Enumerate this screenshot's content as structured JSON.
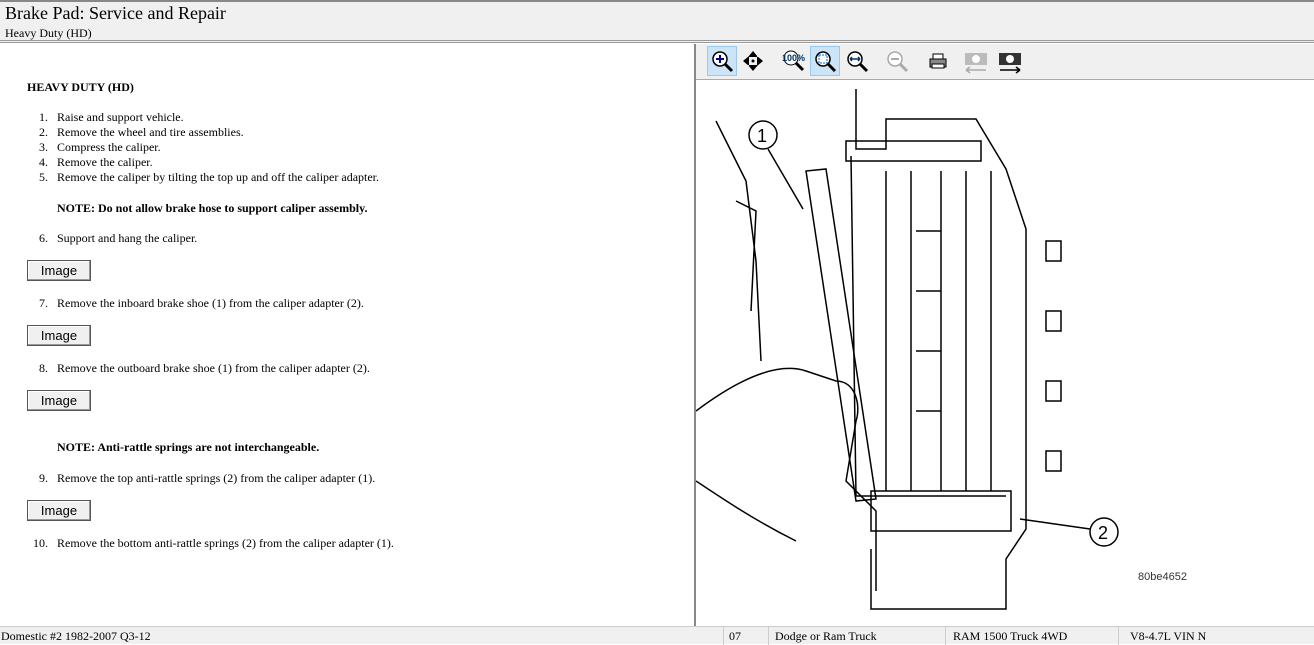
{
  "header": {
    "title": "Brake Pad:  Service and Repair",
    "subtitle": "Heavy Duty (HD)"
  },
  "content": {
    "heading": "HEAVY DUTY (HD)",
    "steps": [
      {
        "n": "1.",
        "text": "Raise and support vehicle."
      },
      {
        "n": "2.",
        "text": "Remove the wheel and tire assemblies."
      },
      {
        "n": "3.",
        "text": "Compress the caliper."
      },
      {
        "n": "4.",
        "text": "Remove the caliper."
      },
      {
        "n": "5.",
        "text": "Remove the caliper by tilting the top up and off the caliper adapter."
      },
      {
        "n": "6.",
        "text": "Support and hang the caliper."
      },
      {
        "n": "7.",
        "text": "Remove the inboard brake shoe (1) from the caliper adapter (2)."
      },
      {
        "n": "8.",
        "text": "Remove the outboard brake shoe (1) from the caliper adapter (2)."
      },
      {
        "n": "9.",
        "text": "Remove the top anti-rattle springs (2) from the caliper adapter (1)."
      },
      {
        "n": "10.",
        "text": "Remove the bottom anti-rattle springs (2) from the caliper adapter (1)."
      }
    ],
    "note1": "NOTE: Do not allow brake hose to support caliper assembly.",
    "note2": "NOTE: Anti-rattle springs are not interchangeable.",
    "image_button": "Image"
  },
  "toolbar": {
    "icons": [
      "zoom-in-icon",
      "pan-icon",
      "zoom-100-icon",
      "zoom-fit-icon",
      "zoom-width-icon",
      "zoom-out-icon",
      "print-icon",
      "previous-image-icon",
      "next-image-icon"
    ]
  },
  "figure": {
    "callout1": "1",
    "callout2": "2",
    "figure_id": "80be4652"
  },
  "status": {
    "database": "Domestic #2 1982-2007 Q3-12",
    "year": "07",
    "make": "Dodge or Ram Truck",
    "model": "RAM 1500 Truck 4WD",
    "engine": "V8-4.7L VIN N"
  }
}
